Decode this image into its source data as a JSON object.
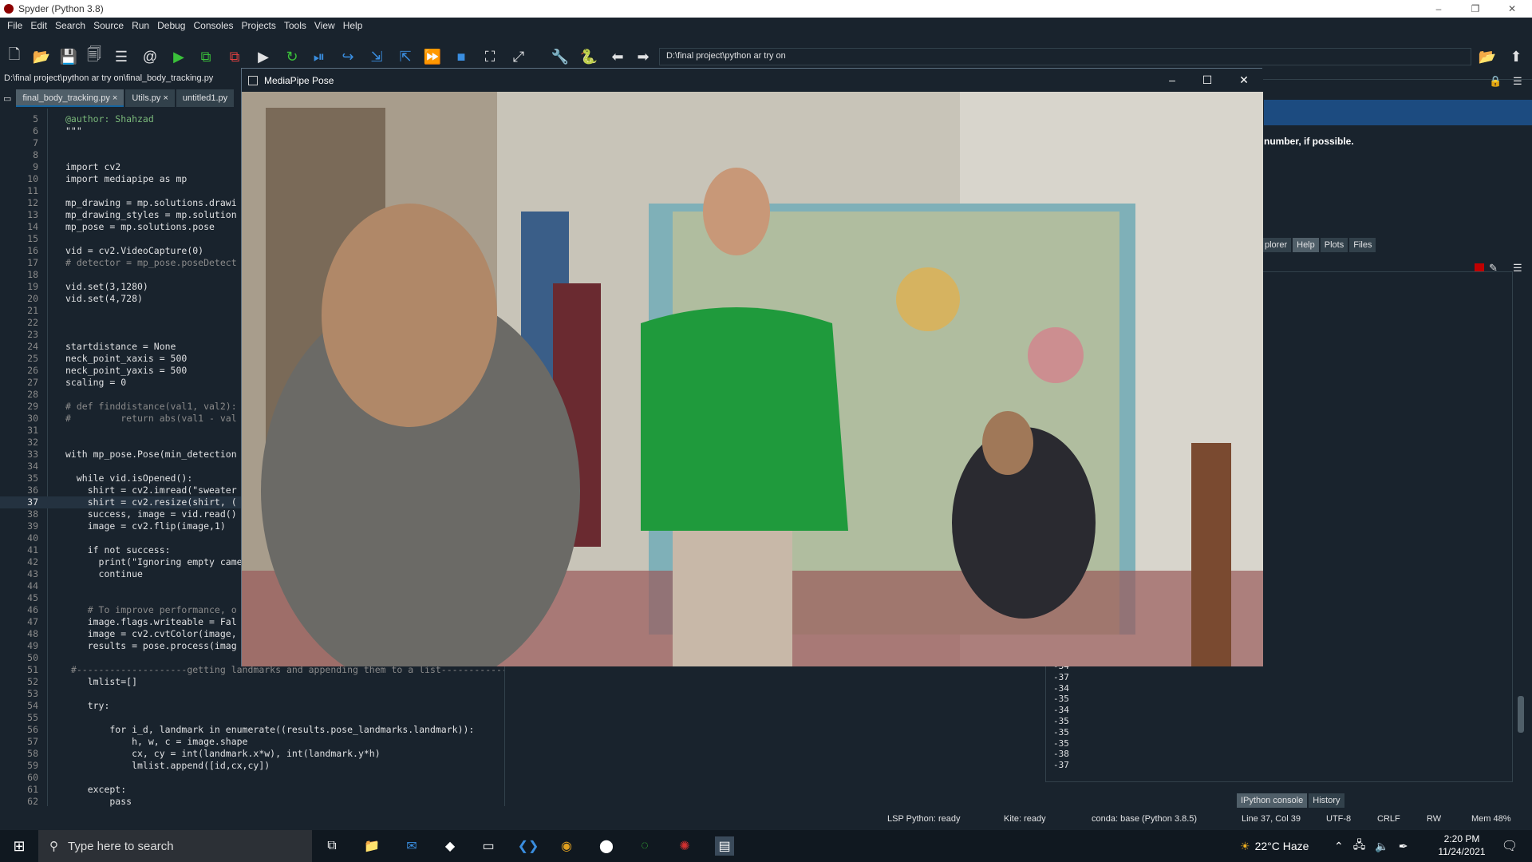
{
  "window": {
    "title": "Spyder (Python 3.8)"
  },
  "menu": [
    "File",
    "Edit",
    "Search",
    "Source",
    "Run",
    "Debug",
    "Consoles",
    "Projects",
    "Tools",
    "View",
    "Help"
  ],
  "toolbar": {
    "path": "D:\\final project\\python ar try on",
    "icons": [
      "new-file",
      "open-file",
      "save",
      "save-all",
      "list",
      "at",
      "run",
      "run-cell",
      "run-cell-advance",
      "run-selection",
      "rerun",
      "debug",
      "step",
      "step-into",
      "step-out",
      "continue",
      "stop",
      "maximize",
      "fullscreen",
      "wrench",
      "python",
      "back",
      "forward"
    ]
  },
  "editor": {
    "path": "D:\\final project\\python ar try on\\final_body_tracking.py",
    "tabs": [
      "final_body_tracking.py",
      "Utils.py",
      "untitled1.py"
    ],
    "current_line": 37,
    "lines": [
      {
        "n": "5",
        "t": "@author: Shahzad"
      },
      {
        "n": "6",
        "t": "\"\"\""
      },
      {
        "n": "7",
        "t": ""
      },
      {
        "n": "8",
        "t": ""
      },
      {
        "n": "9",
        "t": "import cv2"
      },
      {
        "n": "10",
        "t": "import mediapipe as mp"
      },
      {
        "n": "11",
        "t": ""
      },
      {
        "n": "12",
        "t": "mp_drawing = mp.solutions.drawi"
      },
      {
        "n": "13",
        "t": "mp_drawing_styles = mp.solution"
      },
      {
        "n": "14",
        "t": "mp_pose = mp.solutions.pose"
      },
      {
        "n": "15",
        "t": ""
      },
      {
        "n": "16",
        "t": "vid = cv2.VideoCapture(0)"
      },
      {
        "n": "17",
        "t": "# detector = mp_pose.poseDetect"
      },
      {
        "n": "18",
        "t": ""
      },
      {
        "n": "19",
        "t": "vid.set(3,1280)"
      },
      {
        "n": "20",
        "t": "vid.set(4,728)"
      },
      {
        "n": "21",
        "t": ""
      },
      {
        "n": "22",
        "t": ""
      },
      {
        "n": "23",
        "t": ""
      },
      {
        "n": "24",
        "t": "startdistance = None"
      },
      {
        "n": "25",
        "t": "neck_point_xaxis = 500"
      },
      {
        "n": "26",
        "t": "neck_point_yaxis = 500"
      },
      {
        "n": "27",
        "t": "scaling = 0"
      },
      {
        "n": "28",
        "t": ""
      },
      {
        "n": "29",
        "t": "# def finddistance(val1, val2):"
      },
      {
        "n": "30",
        "t": "#         return abs(val1 - val"
      },
      {
        "n": "31",
        "t": ""
      },
      {
        "n": "32",
        "t": ""
      },
      {
        "n": "33",
        "t": "with mp_pose.Pose(min_detection"
      },
      {
        "n": "34",
        "t": ""
      },
      {
        "n": "35",
        "t": "  while vid.isOpened():"
      },
      {
        "n": "36",
        "t": "    shirt = cv2.imread(\"sweater"
      },
      {
        "n": "37",
        "t": "    shirt = cv2.resize(shirt, ("
      },
      {
        "n": "38",
        "t": "    success, image = vid.read()"
      },
      {
        "n": "39",
        "t": "    image = cv2.flip(image,1)"
      },
      {
        "n": "40",
        "t": ""
      },
      {
        "n": "41",
        "t": "    if not success:"
      },
      {
        "n": "42",
        "t": "      print(\"Ignoring empty came"
      },
      {
        "n": "43",
        "t": "      continue"
      },
      {
        "n": "44",
        "t": ""
      },
      {
        "n": "45",
        "t": ""
      },
      {
        "n": "46",
        "t": "    # To improve performance, o"
      },
      {
        "n": "47",
        "t": "    image.flags.writeable = Fal"
      },
      {
        "n": "48",
        "t": "    image = cv2.cvtColor(image,"
      },
      {
        "n": "49",
        "t": "    results = pose.process(imag"
      },
      {
        "n": "50",
        "t": ""
      },
      {
        "n": "51",
        "t": " #--------------------getting landmarks and appending them to a list-------------------------"
      },
      {
        "n": "52",
        "t": "    lmlist=[]"
      },
      {
        "n": "53",
        "t": ""
      },
      {
        "n": "54",
        "t": "    try:"
      },
      {
        "n": "55",
        "t": ""
      },
      {
        "n": "56",
        "t": "        for i_d, landmark in enumerate((results.pose_landmarks.landmark)):"
      },
      {
        "n": "57",
        "t": "            h, w, c = image.shape"
      },
      {
        "n": "58",
        "t": "            cx, cy = int(landmark.x*w), int(landmark.y*h)"
      },
      {
        "n": "59",
        "t": "            lmlist.append([id,cx,cy])"
      },
      {
        "n": "60",
        "t": ""
      },
      {
        "n": "61",
        "t": "    except:"
      },
      {
        "n": "62",
        "t": "        pass"
      }
    ]
  },
  "help_pane": {
    "text": "number, if possible.",
    "tabs": [
      "plorer",
      "Help",
      "Plots",
      "Files"
    ],
    "active_tab": "Help"
  },
  "console": {
    "lines": [
      "-34",
      "-37",
      "-34",
      "-35",
      "-34",
      "-35",
      "-35",
      "-35",
      "-38",
      "-37"
    ],
    "tabs": [
      "IPython console",
      "History"
    ],
    "active_tab": "IPython console"
  },
  "cv_window": {
    "title": "MediaPipe Pose",
    "controls": [
      "–",
      "☐",
      "✕"
    ]
  },
  "status": {
    "lsp": "LSP Python: ready",
    "kite": "Kite: ready",
    "conda": "conda: base (Python 3.8.5)",
    "position": "Line 37, Col 39",
    "encoding": "UTF-8",
    "eol": "CRLF",
    "perm": "RW",
    "mem": "Mem 48%"
  },
  "taskbar": {
    "search_placeholder": "Type here to search",
    "weather": "22°C  Haze",
    "time": "2:20 PM",
    "date": "11/24/2021"
  },
  "colors": {
    "bg": "#19232d",
    "border": "#32414b",
    "accent": "#1464a0",
    "sweater": "#1f9a3c"
  }
}
